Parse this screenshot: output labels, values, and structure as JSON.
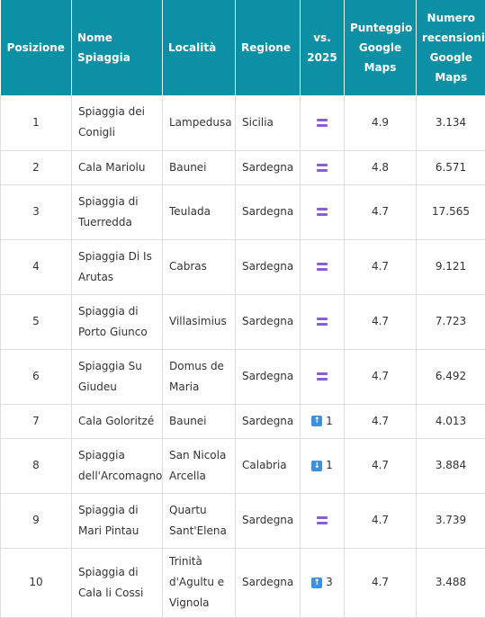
{
  "headers": {
    "posizione": "Posizione",
    "nome": "Nome Spiaggia",
    "localita": "Località",
    "regione": "Regione",
    "vs": "vs. 2025",
    "punteggio": "Punteggio Google Maps",
    "recensioni": "Numero recensioni Google Maps"
  },
  "rows": [
    {
      "pos": "1",
      "nome": "Spiaggia dei Conigli",
      "localita": "Lampedusa",
      "regione": "Sicilia",
      "vs": {
        "type": "same",
        "icon": "equals-icon"
      },
      "punteggio": "4.9",
      "recensioni": "3.134"
    },
    {
      "pos": "2",
      "nome": "Cala Mariolu",
      "localita": "Baunei",
      "regione": "Sardegna",
      "vs": {
        "type": "same",
        "icon": "equals-icon"
      },
      "punteggio": "4.8",
      "recensioni": "6.571"
    },
    {
      "pos": "3",
      "nome": "Spiaggia di Tuerredda",
      "localita": "Teulada",
      "regione": "Sardegna",
      "vs": {
        "type": "same",
        "icon": "equals-icon"
      },
      "punteggio": "4.7",
      "recensioni": "17.565"
    },
    {
      "pos": "4",
      "nome": "Spiaggia Di Is Arutas",
      "localita": "Cabras",
      "regione": "Sardegna",
      "vs": {
        "type": "same",
        "icon": "equals-icon"
      },
      "punteggio": "4.7",
      "recensioni": "9.121"
    },
    {
      "pos": "5",
      "nome": "Spiaggia di Porto Giunco",
      "localita": "Villasimius",
      "regione": "Sardegna",
      "vs": {
        "type": "same",
        "icon": "equals-icon"
      },
      "punteggio": "4.7",
      "recensioni": "7.723"
    },
    {
      "pos": "6",
      "nome": "Spiaggia Su Giudeu",
      "localita": "Domus de Maria",
      "regione": "Sardegna",
      "vs": {
        "type": "same",
        "icon": "equals-icon"
      },
      "punteggio": "4.7",
      "recensioni": "6.492"
    },
    {
      "pos": "7",
      "nome": "Cala Goloritzé",
      "localita": "Baunei",
      "regione": "Sardegna",
      "vs": {
        "type": "up",
        "icon": "arrow-up-icon",
        "glyph": "↑",
        "change": "1"
      },
      "punteggio": "4.7",
      "recensioni": "4.013"
    },
    {
      "pos": "8",
      "nome": "Spiaggia dell'Arcomagno",
      "localita": "San Nicola Arcella",
      "regione": "Calabria",
      "vs": {
        "type": "down",
        "icon": "arrow-down-icon",
        "glyph": "↓",
        "change": "1"
      },
      "punteggio": "4.7",
      "recensioni": "3.884"
    },
    {
      "pos": "9",
      "nome": "Spiaggia di Mari Pintau",
      "localita": "Quartu Sant'Elena",
      "regione": "Sardegna",
      "vs": {
        "type": "same",
        "icon": "equals-icon"
      },
      "punteggio": "4.7",
      "recensioni": "3.739"
    },
    {
      "pos": "10",
      "nome": "Spiaggia di Cala li Cossi",
      "localita": "Trinità d'Agultu e Vignola",
      "regione": "Sardegna",
      "vs": {
        "type": "up",
        "icon": "arrow-up-icon",
        "glyph": "↑",
        "change": "3"
      },
      "punteggio": "4.7",
      "recensioni": "3.488"
    }
  ],
  "colors": {
    "header_bg": "#0d8fa6",
    "equals": "#8a5cd6",
    "arrow": "#3d8fe0"
  }
}
